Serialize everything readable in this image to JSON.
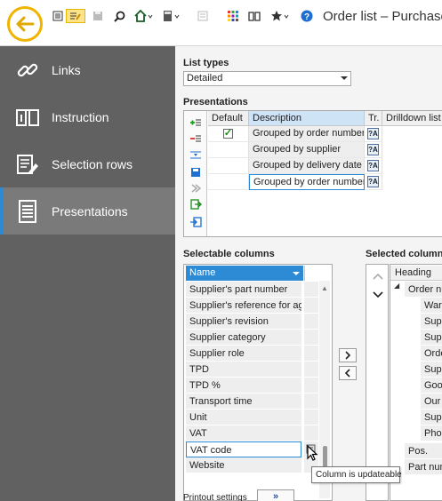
{
  "window": {
    "title": "Order list – Purchase"
  },
  "toolbar": {
    "icons": [
      "back-icon",
      "list-icon",
      "edit-list-icon",
      "save-icon",
      "search-icon",
      "home-icon",
      "calculator-icon",
      "copy-icon",
      "apps-grid-icon",
      "book-icon",
      "favorite-star-icon",
      "help-icon"
    ]
  },
  "nav": {
    "items": [
      {
        "label": "Links",
        "icon": "link-icon"
      },
      {
        "label": "Instruction",
        "icon": "book-icon"
      },
      {
        "label": "Selection rows",
        "icon": "selection-rows-icon"
      },
      {
        "label": "Presentations",
        "icon": "document-lines-icon",
        "active": true
      }
    ]
  },
  "list_types": {
    "label": "List types",
    "value": "Detailed"
  },
  "presentations": {
    "label": "Presentations",
    "columns": [
      "Default",
      "Description",
      "Tr.",
      "Drilldown list typ"
    ],
    "rows": [
      {
        "default": true,
        "description": "Grouped by order number"
      },
      {
        "default": false,
        "description": "Grouped by supplier"
      },
      {
        "default": false,
        "description": "Grouped by delivery date"
      },
      {
        "default": false,
        "description": "Grouped by order number !"
      }
    ]
  },
  "selectable_columns": {
    "label": "Selectable columns",
    "header": "Name",
    "items": [
      "Supplier's part number",
      "Supplier's reference for agr...",
      "Supplier's revision",
      "Supplier category",
      "Supplier role",
      "TPD",
      "TPD %",
      "Transport time",
      "Unit",
      "VAT",
      "VAT code",
      "Website"
    ],
    "selected": "VAT code"
  },
  "selected_columns": {
    "label": "Selected columns",
    "header": "Heading",
    "tree": [
      "Order nu",
      "Ware",
      "Supp",
      "Supp",
      "Orde",
      "Supp",
      "Good",
      "Our r",
      "Supp",
      "Phon",
      "Pos.",
      "Part num"
    ]
  },
  "tooltip": {
    "text": "Column is updateable"
  },
  "printout": {
    "label": "Printout settings",
    "button": "»"
  },
  "colors": {
    "accent": "#2d8bd6",
    "nav_bg": "#616161",
    "back_ring": "#f0b400"
  }
}
